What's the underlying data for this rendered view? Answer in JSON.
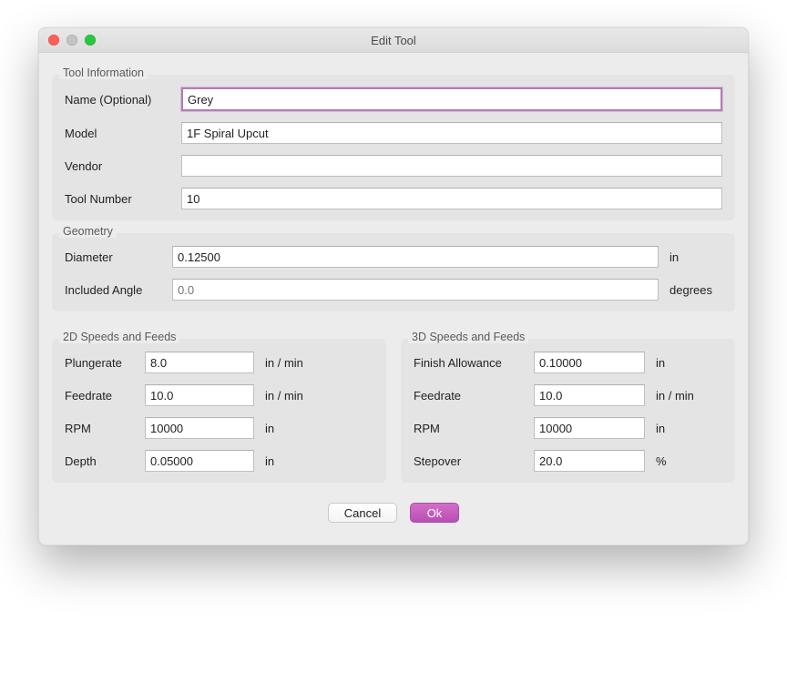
{
  "window": {
    "title": "Edit Tool"
  },
  "groups": {
    "tool_info": {
      "legend": "Tool Information",
      "name_label": "Name (Optional)",
      "name_value": "Grey",
      "model_label": "Model",
      "model_value": "1F Spiral Upcut",
      "vendor_label": "Vendor",
      "vendor_value": "",
      "toolnum_label": "Tool Number",
      "toolnum_value": "10"
    },
    "geometry": {
      "legend": "Geometry",
      "diameter_label": "Diameter",
      "diameter_value": "0.12500",
      "diameter_unit": "in",
      "angle_label": "Included Angle",
      "angle_value": "",
      "angle_placeholder": "0.0",
      "angle_unit": "degrees"
    },
    "sf2d": {
      "legend": "2D Speeds and Feeds",
      "plungerate_label": "Plungerate",
      "plungerate_value": "8.0",
      "plungerate_unit": "in / min",
      "feedrate_label": "Feedrate",
      "feedrate_value": "10.0",
      "feedrate_unit": "in / min",
      "rpm_label": "RPM",
      "rpm_value": "10000",
      "rpm_unit": "in",
      "depth_label": "Depth",
      "depth_value": "0.05000",
      "depth_unit": "in"
    },
    "sf3d": {
      "legend": "3D Speeds and Feeds",
      "finish_label": "Finish Allowance",
      "finish_value": "0.10000",
      "finish_unit": "in",
      "feedrate_label": "Feedrate",
      "feedrate_value": "10.0",
      "feedrate_unit": "in / min",
      "rpm_label": "RPM",
      "rpm_value": "10000",
      "rpm_unit": "in",
      "stepover_label": "Stepover",
      "stepover_value": "20.0",
      "stepover_unit": "%"
    }
  },
  "footer": {
    "cancel": "Cancel",
    "ok": "Ok"
  }
}
